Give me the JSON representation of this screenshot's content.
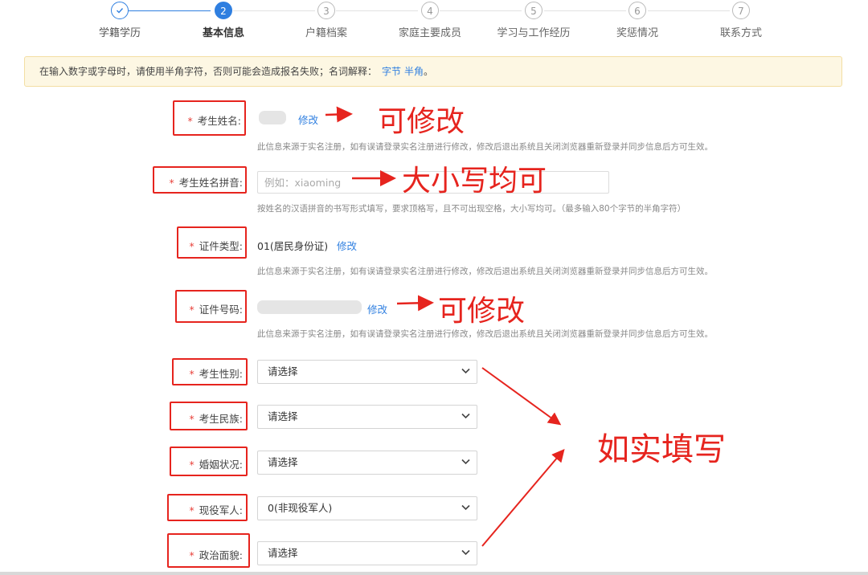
{
  "steps": [
    {
      "num": "",
      "label": "学籍学历",
      "state": "done"
    },
    {
      "num": "2",
      "label": "基本信息",
      "state": "active"
    },
    {
      "num": "3",
      "label": "户籍档案",
      "state": "todo"
    },
    {
      "num": "4",
      "label": "家庭主要成员",
      "state": "todo"
    },
    {
      "num": "5",
      "label": "学习与工作经历",
      "state": "todo"
    },
    {
      "num": "6",
      "label": "奖惩情况",
      "state": "todo"
    },
    {
      "num": "7",
      "label": "联系方式",
      "state": "todo"
    }
  ],
  "notice": {
    "text": "在输入数字或字母时，请使用半角字符，否则可能会造成报名失败；名词解释：",
    "link1": "字节",
    "link2": "半角",
    "end": "。"
  },
  "required_mark": "*",
  "form": {
    "name": {
      "label": "考生姓名:",
      "edit": "修改",
      "help": "此信息来源于实名注册，如有误请登录实名注册进行修改，修改后退出系统且关闭浏览器重新登录并同步信息后方可生效。"
    },
    "pinyin": {
      "label": "考生姓名拼音:",
      "placeholder": "例如：xiaoming",
      "help": "按姓名的汉语拼音的书写形式填写，要求顶格写，且不可出现空格，大小写均可。（最多输入80个字节的半角字符）"
    },
    "id_type": {
      "label": "证件类型:",
      "value": "01(居民身份证)",
      "edit": "修改",
      "help": "此信息来源于实名注册，如有误请登录实名注册进行修改，修改后退出系统且关闭浏览器重新登录并同步信息后方可生效。"
    },
    "id_number": {
      "label": "证件号码:",
      "edit": "修改",
      "help": "此信息来源于实名注册，如有误请登录实名注册进行修改，修改后退出系统且关闭浏览器重新登录并同步信息后方可生效。"
    },
    "gender": {
      "label": "考生性别:",
      "value": "请选择"
    },
    "ethnicity": {
      "label": "考生民族:",
      "value": "请选择"
    },
    "marital": {
      "label": "婚姻状况:",
      "value": "请选择"
    },
    "military": {
      "label": "现役军人:",
      "value": "0(非现役军人)"
    },
    "political": {
      "label": "政治面貌:",
      "value": "请选择"
    }
  },
  "annotations": {
    "name_note": "可修改",
    "pinyin_note": "大小写均可",
    "id_note": "可修改",
    "fill_note": "如实填写"
  },
  "colors": {
    "accent": "#2f7fe0",
    "annotation": "#e6241e",
    "notice_bg": "#fdf7e3",
    "required": "#e8413a"
  },
  "icons": {
    "step_done": "check-icon",
    "select": "chevron-down-icon"
  }
}
